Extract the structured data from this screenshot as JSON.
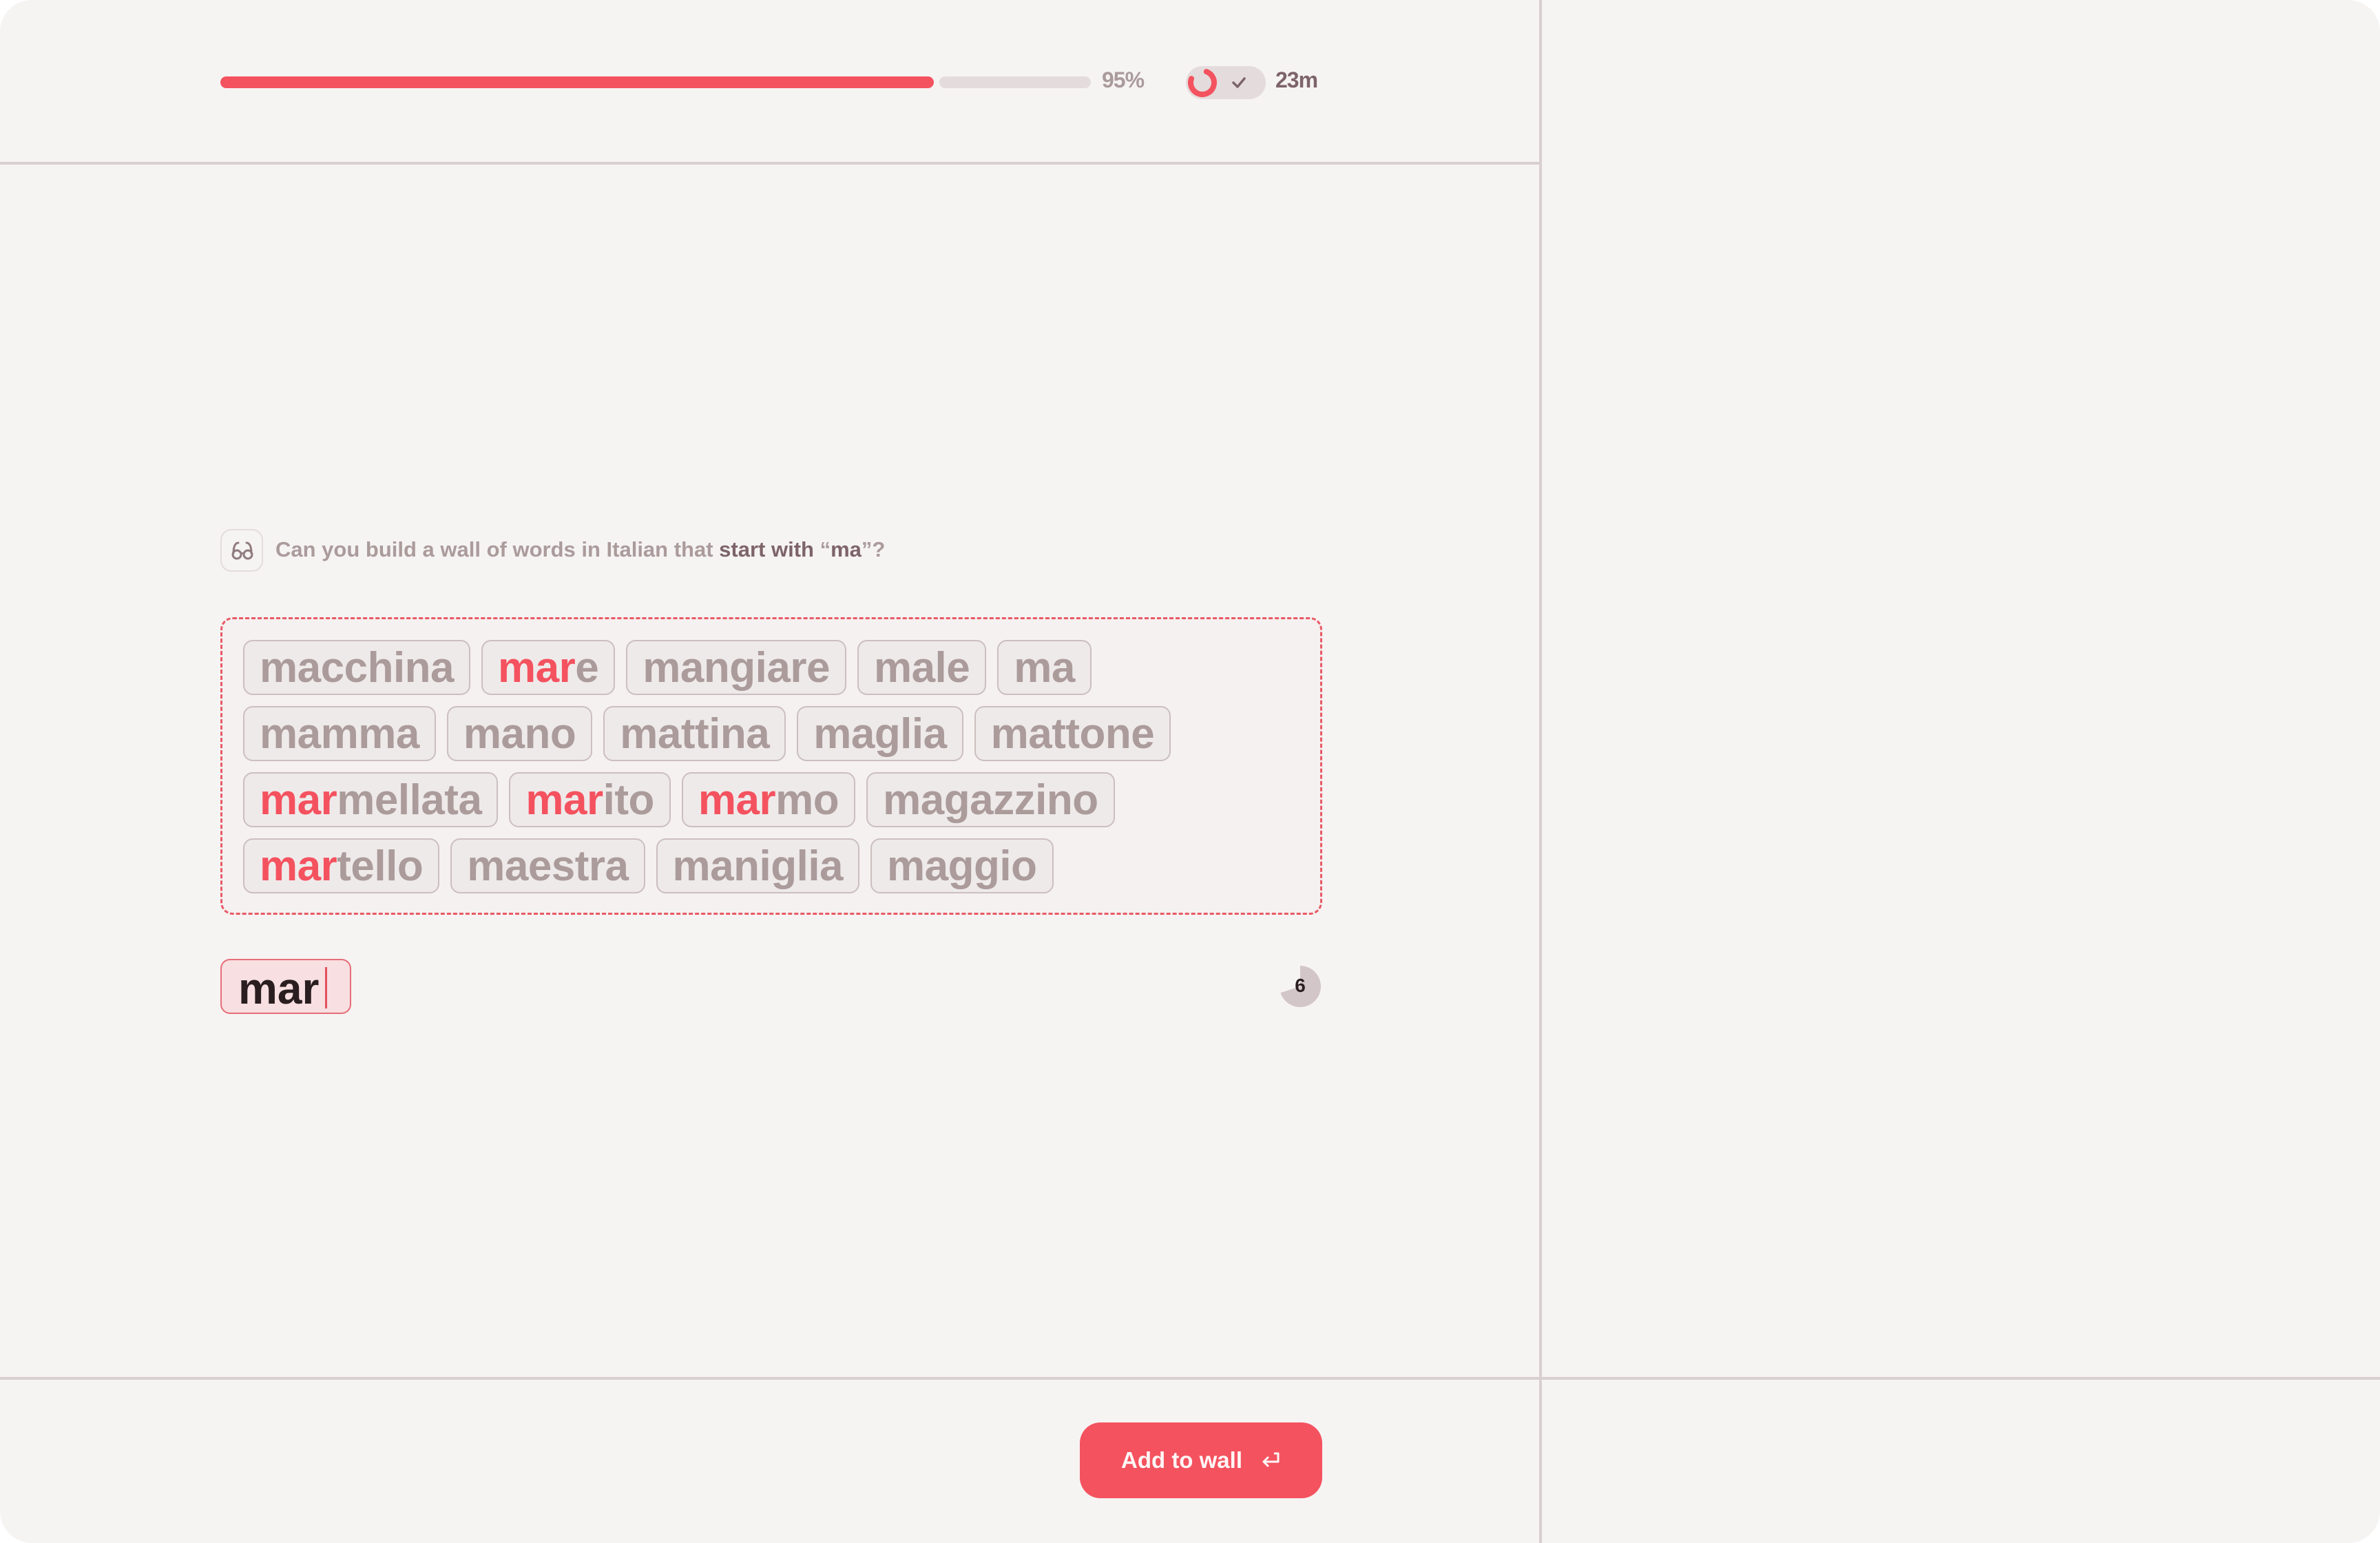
{
  "header": {
    "progress_percent": 95,
    "progress_label": "95%",
    "timer_ring_fraction": 0.75,
    "timer_label": "23m",
    "toggle_icon": "check-icon"
  },
  "prompt": {
    "icon": "glasses-icon",
    "text_plain": "Can you build a wall of words in Italian that ",
    "text_strong": "start with",
    "quote_open": " “",
    "text_strong_2": "ma",
    "quote_close": "”?"
  },
  "wall": {
    "rows": [
      [
        {
          "hl": "",
          "rest": "macchina"
        },
        {
          "hl": "mar",
          "rest": "e"
        },
        {
          "hl": "",
          "rest": "mangiare"
        },
        {
          "hl": "",
          "rest": "male"
        },
        {
          "hl": "",
          "rest": "ma"
        }
      ],
      [
        {
          "hl": "",
          "rest": "mamma"
        },
        {
          "hl": "",
          "rest": "mano"
        },
        {
          "hl": "",
          "rest": "mattina"
        },
        {
          "hl": "",
          "rest": "maglia"
        },
        {
          "hl": "",
          "rest": "mattone"
        }
      ],
      [
        {
          "hl": "mar",
          "rest": "mellata"
        },
        {
          "hl": "mar",
          "rest": "ito"
        },
        {
          "hl": "mar",
          "rest": "mo"
        },
        {
          "hl": "",
          "rest": "magazzino"
        }
      ],
      [
        {
          "hl": "mar",
          "rest": "tello"
        },
        {
          "hl": "",
          "rest": "maestra"
        },
        {
          "hl": "",
          "rest": "maniglia"
        },
        {
          "hl": "",
          "rest": "maggio"
        }
      ]
    ]
  },
  "input": {
    "value": "mar"
  },
  "counter": {
    "value": "6",
    "fill_fraction": 0.7
  },
  "footer": {
    "add_button_label": "Add to wall",
    "add_button_icon": "enter-icon"
  },
  "colors": {
    "accent": "#f4525f",
    "muted_text": "#ab9b9b",
    "strong_text": "#7d6468",
    "background": "#f6f3f3"
  }
}
